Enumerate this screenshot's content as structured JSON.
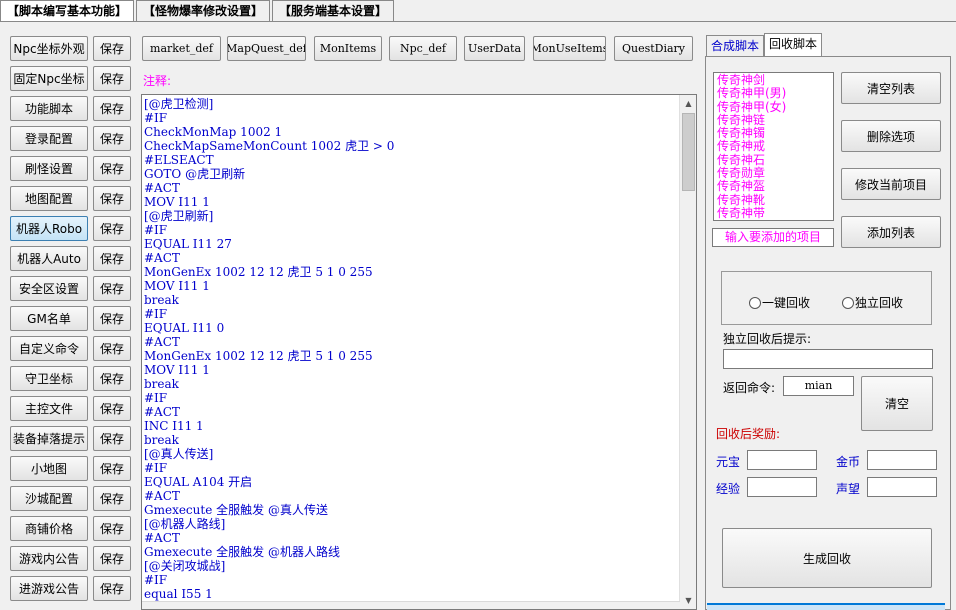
{
  "top_tabs": [
    "【脚本编写基本功能】",
    "【怪物爆率修改设置】",
    "【服务端基本设置】"
  ],
  "left_buttons": [
    {
      "label": "Npc坐标外观",
      "save": "保存"
    },
    {
      "label": "固定Npc坐标",
      "save": "保存"
    },
    {
      "label": "功能脚本",
      "save": "保存"
    },
    {
      "label": "登录配置",
      "save": "保存"
    },
    {
      "label": "刷怪设置",
      "save": "保存"
    },
    {
      "label": "地图配置",
      "save": "保存"
    },
    {
      "label": "机器人Robo",
      "save": "保存"
    },
    {
      "label": "机器人Auto",
      "save": "保存"
    },
    {
      "label": "安全区设置",
      "save": "保存"
    },
    {
      "label": "GM名单",
      "save": "保存"
    },
    {
      "label": "自定义命令",
      "save": "保存"
    },
    {
      "label": "守卫坐标",
      "save": "保存"
    },
    {
      "label": "主控文件",
      "save": "保存"
    },
    {
      "label": "装备掉落提示",
      "save": "保存"
    },
    {
      "label": "小地图",
      "save": "保存"
    },
    {
      "label": "沙城配置",
      "save": "保存"
    },
    {
      "label": "商铺价格",
      "save": "保存"
    },
    {
      "label": "游戏内公告",
      "save": "保存"
    },
    {
      "label": "进游戏公告",
      "save": "保存"
    }
  ],
  "script_buttons": [
    "market_def",
    "MapQuest_def",
    "MonItems",
    "Npc_def",
    "UserData",
    "MonUseItems",
    "QuestDiary"
  ],
  "note_label": "注释:",
  "editor": {
    "code": "[@虎卫检测]\n#IF\nCheckMonMap 1002 1\nCheckMapSameMonCount 1002 虎卫 > 0\n#ELSEACT\nGOTO @虎卫刷新\n#ACT\nMOV I11 1\n[@虎卫刷新]\n#IF\nEQUAL I11 27\n#ACT\nMonGenEx 1002 12 12 虎卫 5 1 0 255\nMOV I11 1\nbreak\n#IF\nEQUAL I11 0\n#ACT\nMonGenEx 1002 12 12 虎卫 5 1 0 255\nMOV I11 1\nbreak\n#IF\n#ACT\nINC I11 1\nbreak\n[@真人传送]\n#IF\nEQUAL A104 开启\n#ACT\nGmexecute 全服触发 @真人传送\n[@机器人路线]\n#ACT\nGmexecute 全服触发 @机器人路线\n[@关闭攻城战]\n#IF\nequal I55 1"
  },
  "right": {
    "tabs": [
      "合成脚本",
      "回收脚本"
    ],
    "list_items": [
      "传奇神剑",
      "传奇神甲(男)",
      "传奇神甲(女)",
      "传奇神链",
      "传奇神镯",
      "传奇神戒",
      "传奇神石",
      "传奇勋章",
      "传奇神盔",
      "传奇神靴",
      "传奇神带"
    ],
    "add_item_placeholder": "输入要添加的项目",
    "buttons": {
      "clear_list": "清空列表",
      "delete_option": "删除选项",
      "modify_current": "修改当前项目",
      "add_list": "添加列表"
    },
    "radio_one_key": "一键回收",
    "radio_independent": "独立回收",
    "independent_hint_label": "独立回收后提示:",
    "independent_hint_value": "",
    "return_cmd_label": "返回命令:",
    "return_cmd_value": "mian",
    "clear_button": "清空",
    "reward_label": "回收后奖励:",
    "yuanbao_label": "元宝",
    "gold_label": "金币",
    "exp_label": "经验",
    "prestige_label": "声望",
    "generate_button": "生成回收"
  },
  "colors": {
    "magenta": "#ff00ff",
    "code_blue": "#0000cc",
    "reward_red": "#cc0000",
    "label_blue": "#0000cc"
  }
}
